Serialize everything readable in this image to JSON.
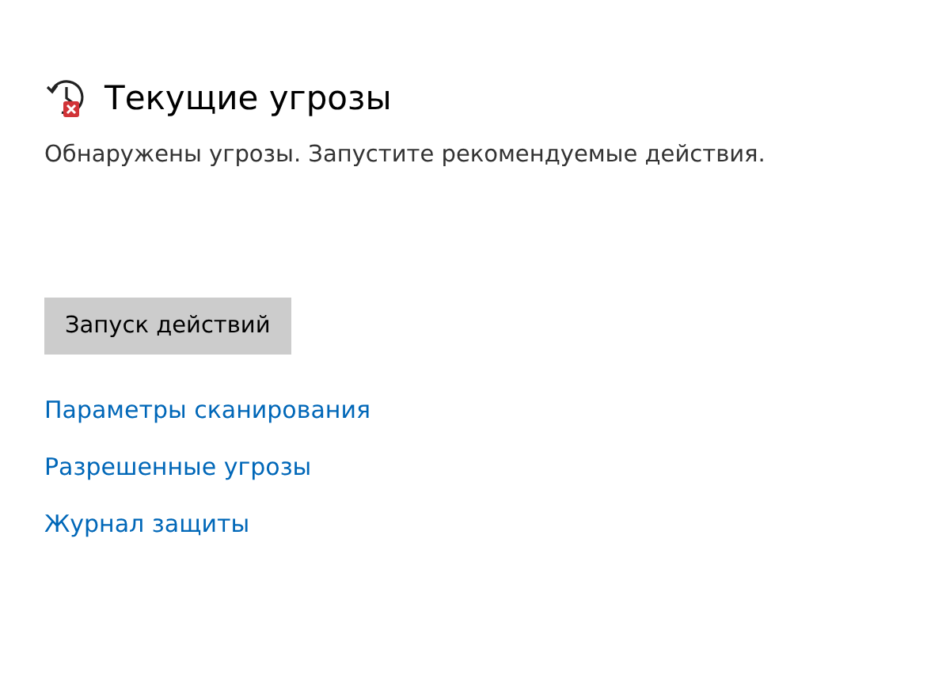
{
  "section": {
    "title": "Текущие угрозы",
    "description": "Обнаружены угрозы. Запустите рекомендуемые действия."
  },
  "buttons": [
    "Запуск действий"
  ],
  "links": [
    "Параметры сканирования",
    "Разрешенные угрозы",
    "Журнал защиты"
  ]
}
